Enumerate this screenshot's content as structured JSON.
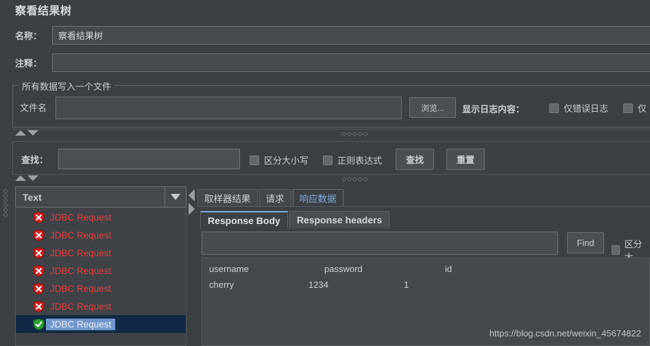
{
  "page": {
    "title": "察看结果树",
    "watermark": "https://blog.csdn.net/weixin_45674822"
  },
  "fields": {
    "name_label": "名称：",
    "name_value": "察看结果树",
    "comment_label": "注释：",
    "comment_value": ""
  },
  "file_group": {
    "legend": "所有数据写入一个文件",
    "filename_label": "文件名",
    "filename_value": "",
    "browse_label": "浏览...",
    "log_content_label": "显示日志内容：",
    "checkbox_error_only": "仅错误日志",
    "checkbox_success_only": "仅"
  },
  "search": {
    "label": "查找：",
    "value": "",
    "case_sensitive_label": "区分大小写",
    "regex_label": "正则表达式",
    "find_button": "查找",
    "reset_button": "重置"
  },
  "tree": {
    "filter_selected": "Text",
    "items": [
      {
        "label": "JDBC Request",
        "status": "error"
      },
      {
        "label": "JDBC Request",
        "status": "error"
      },
      {
        "label": "JDBC Request",
        "status": "error"
      },
      {
        "label": "JDBC Request",
        "status": "error"
      },
      {
        "label": "JDBC Request",
        "status": "error"
      },
      {
        "label": "JDBC Request",
        "status": "error"
      },
      {
        "label": "JDBC Request",
        "status": "success"
      }
    ]
  },
  "right_pane": {
    "tabs": [
      {
        "label": "取样器结果",
        "active": false
      },
      {
        "label": "请求",
        "active": false
      },
      {
        "label": "响应数据",
        "active": true
      }
    ],
    "subtabs": [
      {
        "label": "Response Body",
        "active": true
      },
      {
        "label": "Response headers",
        "active": false
      }
    ],
    "find": {
      "value": "",
      "button_label": "Find",
      "case_sensitive_label": "区分大"
    },
    "response_body": {
      "header_row": [
        "username",
        "password",
        "id"
      ],
      "data_row": [
        "cherry",
        "1234",
        "1"
      ]
    }
  },
  "colors": {
    "background": "#3c4043",
    "accent_blue": "#7fa9e0",
    "error_red": "#e43c3c",
    "success_green": "#2e9e35",
    "selection_blue": "#6f97cc"
  }
}
